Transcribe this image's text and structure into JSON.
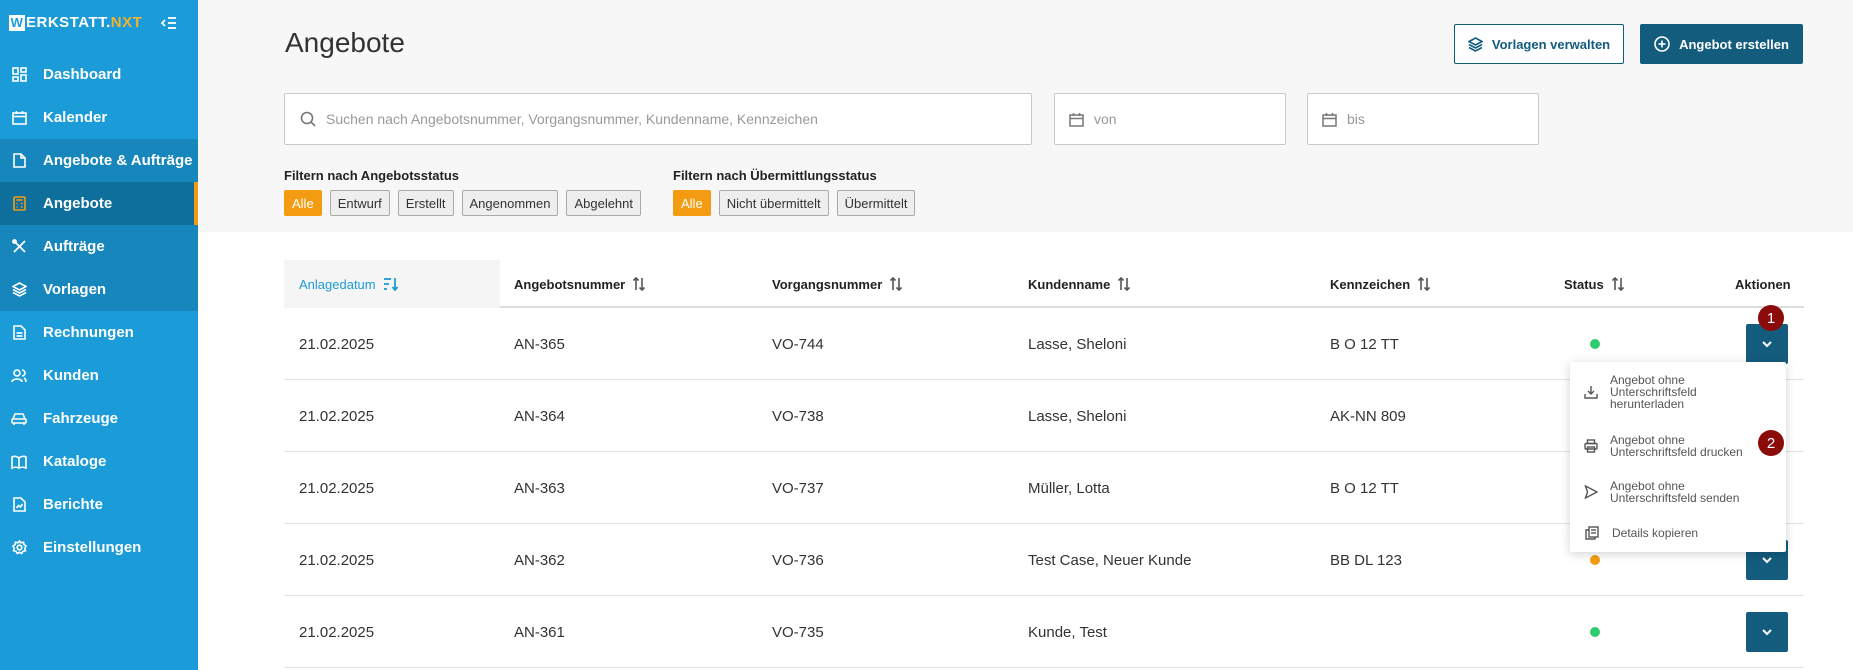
{
  "app": {
    "logo_letter": "W",
    "logo_text": "ERKSTATT.",
    "logo_accent": "NXT",
    "brand_color": "#1b9bd7",
    "accent_color": "#f39c12",
    "primary_button_color": "#145c7e"
  },
  "sidebar": {
    "items": [
      {
        "label": "Dashboard",
        "icon": "dashboard-icon"
      },
      {
        "label": "Kalender",
        "icon": "calendar-icon"
      },
      {
        "label": "Angebote & Aufträge",
        "icon": "document-icon"
      },
      {
        "label": "Angebote",
        "icon": "calculator-icon"
      },
      {
        "label": "Aufträge",
        "icon": "tools-icon"
      },
      {
        "label": "Vorlagen",
        "icon": "layers-icon"
      },
      {
        "label": "Rechnungen",
        "icon": "invoice-icon"
      },
      {
        "label": "Kunden",
        "icon": "users-icon"
      },
      {
        "label": "Fahrzeuge",
        "icon": "car-icon"
      },
      {
        "label": "Kataloge",
        "icon": "book-icon"
      },
      {
        "label": "Berichte",
        "icon": "report-icon"
      },
      {
        "label": "Einstellungen",
        "icon": "gear-icon"
      }
    ]
  },
  "header": {
    "title": "Angebote",
    "manage_templates_label": "Vorlagen verwalten",
    "create_offer_label": "Angebot erstellen"
  },
  "search": {
    "placeholder": "Suchen nach Angebotsnummer, Vorgangsnummer, Kundenname, Kennzeichen"
  },
  "date_from": {
    "placeholder": "von"
  },
  "date_to": {
    "placeholder": "bis"
  },
  "filters": {
    "offer_status_label": "Filtern nach Angebotsstatus",
    "offer_status_options": [
      "Alle",
      "Entwurf",
      "Erstellt",
      "Angenommen",
      "Abgelehnt"
    ],
    "transmission_label": "Filtern nach Übermittlungsstatus",
    "transmission_options": [
      "Alle",
      "Nicht übermittelt",
      "Übermittelt"
    ]
  },
  "table": {
    "columns": [
      "Anlagedatum",
      "Angebotsnummer",
      "Vorgangsnummer",
      "Kundenname",
      "Kennzeichen",
      "Status",
      "Aktionen"
    ],
    "rows": [
      {
        "date": "21.02.2025",
        "offer": "AN-365",
        "process": "VO-744",
        "customer": "Lasse, Sheloni",
        "plate": "B O 12 TT",
        "status_color": "#2ecc71"
      },
      {
        "date": "21.02.2025",
        "offer": "AN-364",
        "process": "VO-738",
        "customer": "Lasse, Sheloni",
        "plate": "AK-NN 809",
        "status_color": ""
      },
      {
        "date": "21.02.2025",
        "offer": "AN-363",
        "process": "VO-737",
        "customer": "Müller, Lotta",
        "plate": "B O 12 TT",
        "status_color": ""
      },
      {
        "date": "21.02.2025",
        "offer": "AN-362",
        "process": "VO-736",
        "customer": "Test Case, Neuer Kunde",
        "plate": "BB DL 123",
        "status_color": "#f39c12"
      },
      {
        "date": "21.02.2025",
        "offer": "AN-361",
        "process": "VO-735",
        "customer": "Kunde, Test",
        "plate": "",
        "status_color": "#2ecc71"
      }
    ]
  },
  "actions_menu": {
    "items": [
      {
        "label": "Angebot ohne Unterschriftsfeld herunterladen",
        "icon": "download-icon"
      },
      {
        "label": "Angebot ohne Unterschriftsfeld drucken",
        "icon": "printer-icon"
      },
      {
        "label": "Angebot ohne Unterschriftsfeld senden",
        "icon": "send-icon"
      },
      {
        "label": "Details kopieren",
        "icon": "copy-icon"
      }
    ]
  },
  "annotations": {
    "badge_1": "1",
    "badge_2": "2"
  }
}
